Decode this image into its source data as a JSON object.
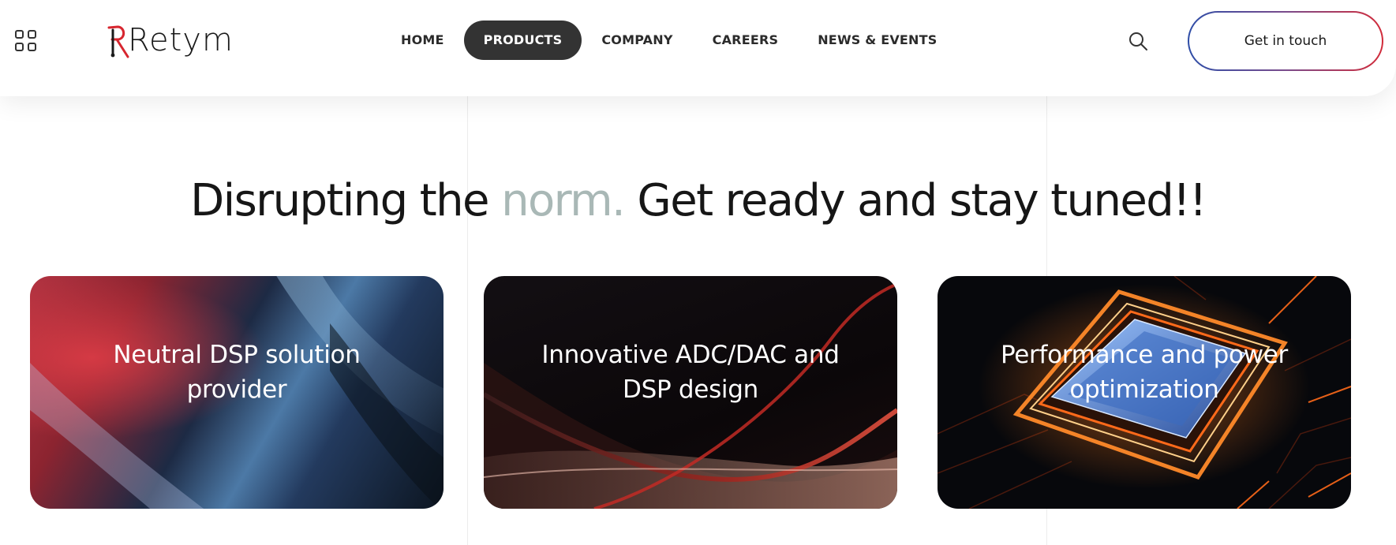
{
  "header": {
    "logo_text": "Retym",
    "nav": [
      {
        "label": "HOME"
      },
      {
        "label": "PRODUCTS",
        "active": true
      },
      {
        "label": "COMPANY"
      },
      {
        "label": "CAREERS"
      },
      {
        "label": "NEWS & EVENTS"
      }
    ],
    "search_icon": "search-icon",
    "menu_icon": "grid-menu-icon",
    "cta_label": "Get in touch"
  },
  "hero": {
    "headline_part1": "Disrupting the ",
    "headline_muted": "norm.",
    "headline_part2": " Get ready and stay tuned!!"
  },
  "cards": [
    {
      "label": "Neutral DSP solution provider"
    },
    {
      "label": "Innovative ADC/DAC and DSP design"
    },
    {
      "label": "Performance and power optimization"
    }
  ],
  "colors": {
    "nav_active_bg": "#333333",
    "headline_muted": "#a9b8b6",
    "cta_gradient_start": "#2e4da7",
    "cta_gradient_end": "#d22b3a",
    "logo_accent": "#d7262f"
  }
}
